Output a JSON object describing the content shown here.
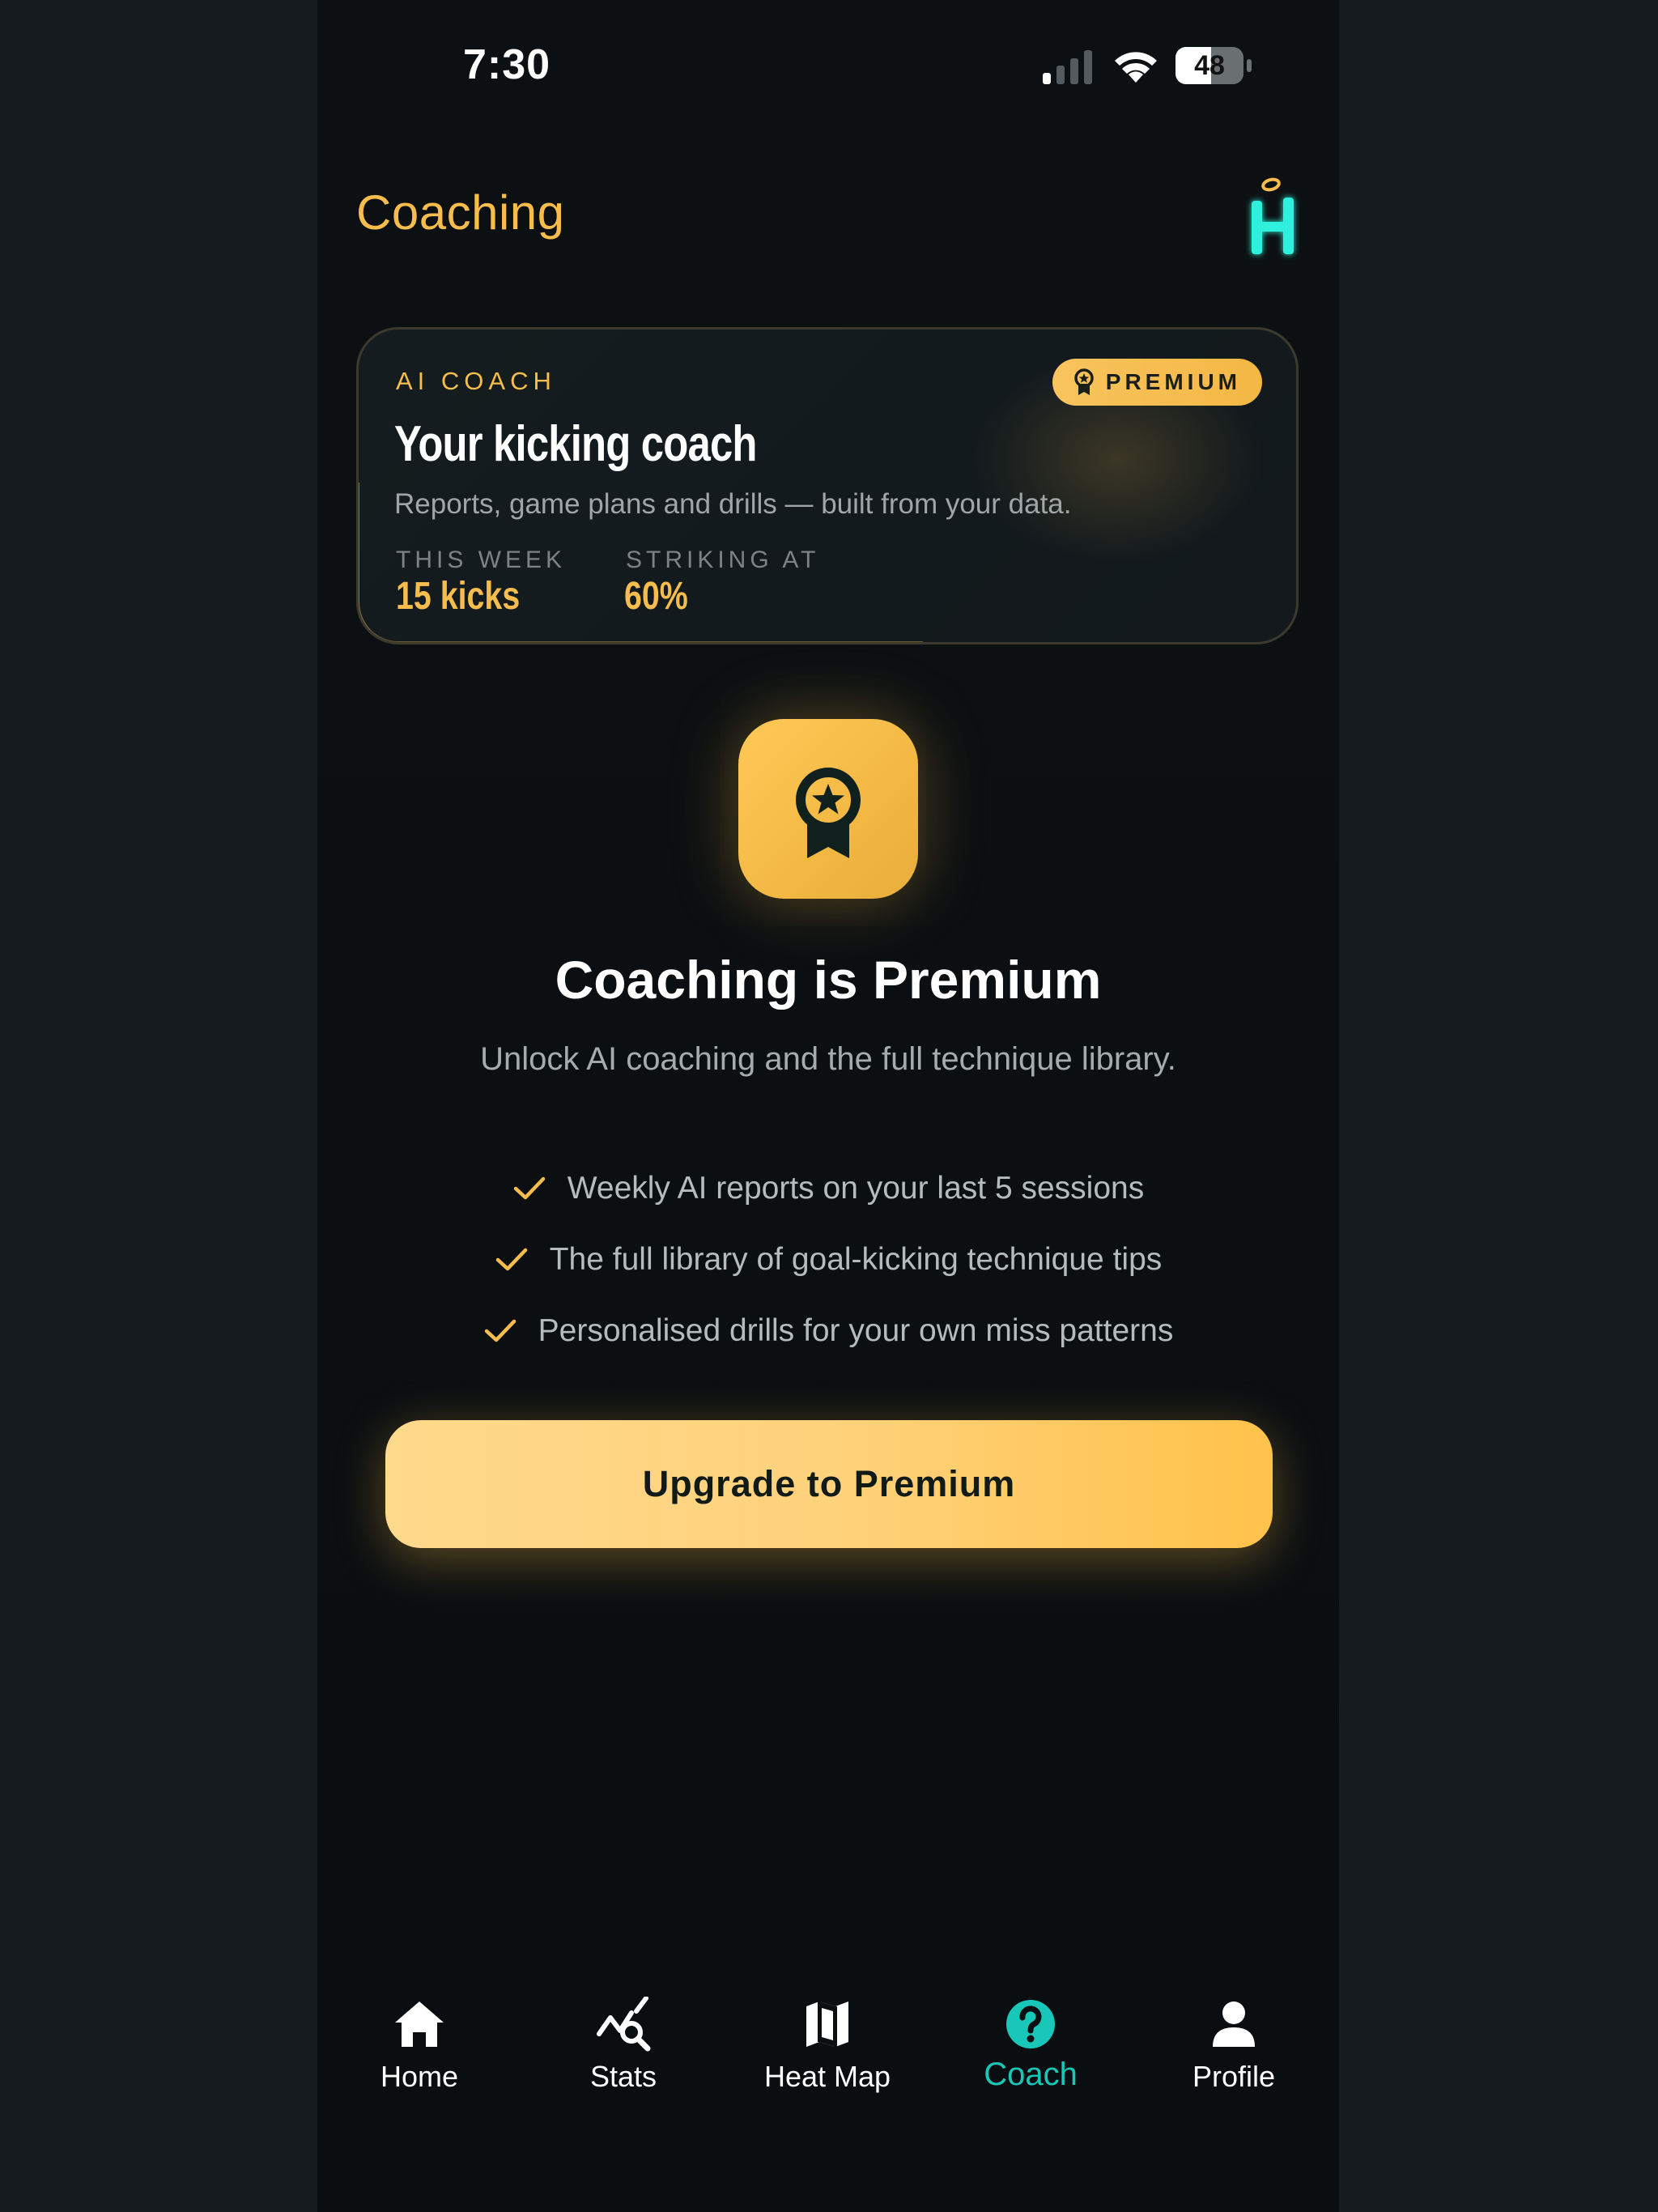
{
  "status_bar": {
    "time": "7:30",
    "battery": "48"
  },
  "header": {
    "title": "Coaching",
    "logo_letter": "H"
  },
  "card": {
    "eyebrow": "AI COACH",
    "badge": "PREMIUM",
    "title": "Your kicking coach",
    "subtitle": "Reports, game plans and drills — built from your data.",
    "stats": [
      {
        "label": "THIS WEEK",
        "value": "15 kicks"
      },
      {
        "label": "STRIKING AT",
        "value": "60%"
      }
    ]
  },
  "promo": {
    "title": "Coaching is Premium",
    "subtitle": "Unlock AI coaching and the full technique library.",
    "features": [
      "Weekly AI reports on your last 5 sessions",
      "The full library of goal-kicking technique tips",
      "Personalised drills for your own miss patterns"
    ],
    "cta": "Upgrade to Premium"
  },
  "tabs": [
    {
      "label": "Home",
      "icon": "home-icon"
    },
    {
      "label": "Stats",
      "icon": "stats-icon"
    },
    {
      "label": "Heat Map",
      "icon": "map-icon"
    },
    {
      "label": "Coach",
      "icon": "question-circle-icon",
      "active": true
    },
    {
      "label": "Profile",
      "icon": "person-icon"
    }
  ],
  "colors": {
    "accent": "#f6bd4c",
    "active_tab": "#18c7b8",
    "logo": "#2ef0dc"
  }
}
